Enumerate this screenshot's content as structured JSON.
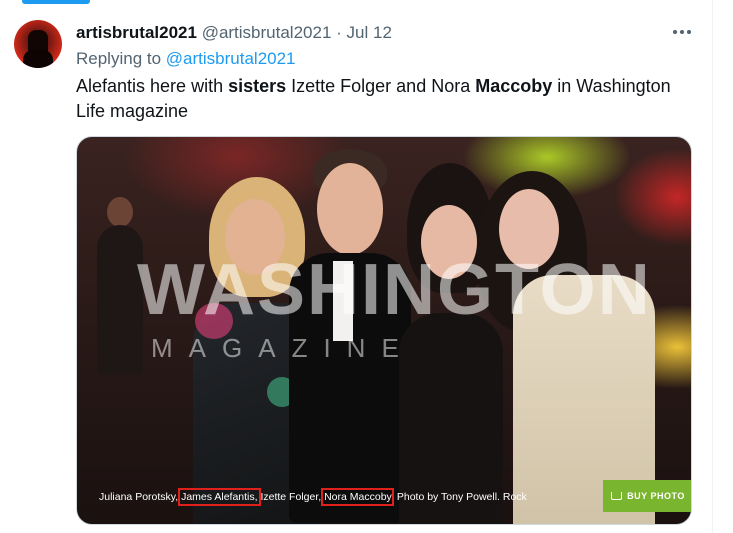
{
  "tweet": {
    "display_name": "artisbrutal2021",
    "handle": "@artisbrutal2021",
    "separator": "·",
    "date": "Jul 12",
    "replying_prefix": "Replying to",
    "replying_handle": "@artisbrutal2021",
    "text": {
      "p1": "Alefantis here with ",
      "b1": "sisters",
      "p2": " Izette Folger and Nora ",
      "b2": "Maccoby",
      "p3": " in Washington Life magazine"
    }
  },
  "media": {
    "watermark_main": "WASHINGTON",
    "watermark_sub": "MAGAZINE",
    "caption": {
      "c1": "Juliana Porotsky, ",
      "c2": "James Alefantis,",
      "c3": " Izette Folger, ",
      "c4": "Nora Maccoby",
      "c5": ". Photo by Tony Powell. Rock"
    },
    "buy_label": "BUY PHOTO"
  },
  "colors": {
    "accent": "#1d9bf0",
    "highlight_box": "#e0201b",
    "buy_button": "#7ab52f"
  },
  "icons": {
    "more": "more-horizontal-icon",
    "cart": "cart-icon"
  }
}
